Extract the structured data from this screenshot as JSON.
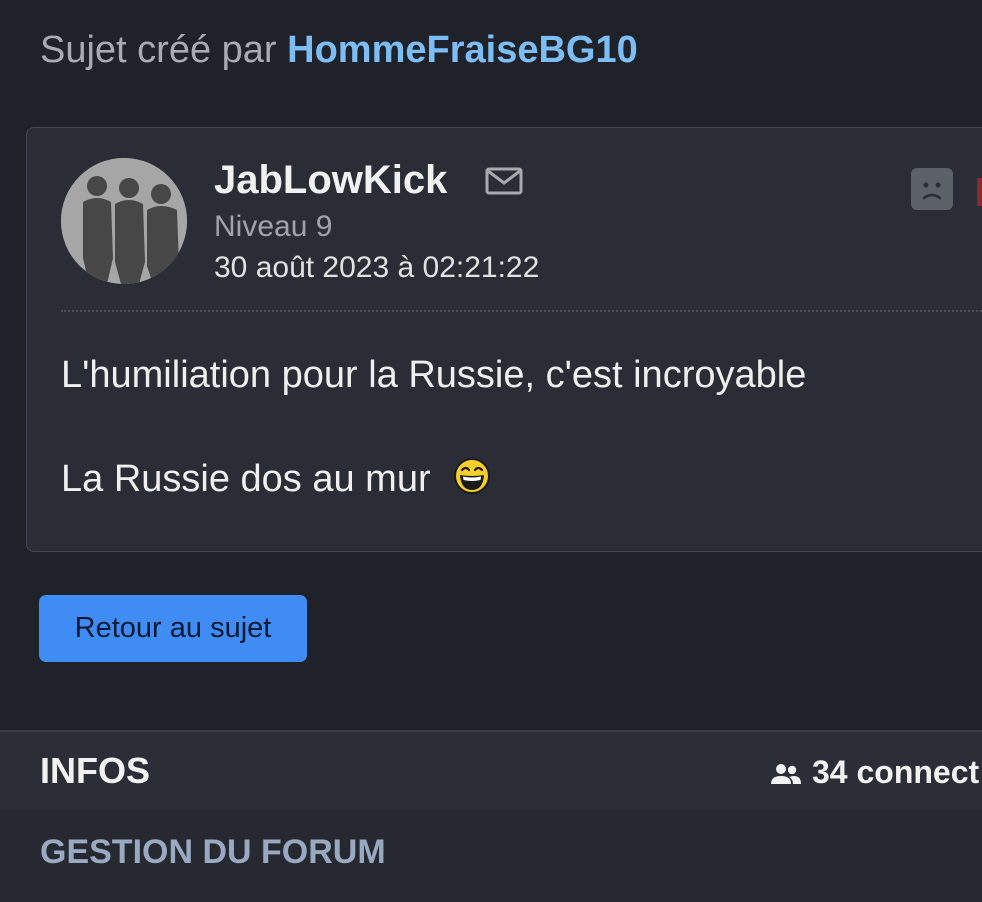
{
  "topic_header": {
    "prefix": "Sujet créé par",
    "author": "HommeFraiseBG10"
  },
  "post": {
    "username": "JabLowKick",
    "level": "Niveau 9",
    "date": "30 août 2023 à 02:21:22",
    "message_lines": [
      "L'humiliation pour la Russie, c'est incroyable",
      "La Russie dos au mur"
    ],
    "icons": {
      "mail": "mail-icon",
      "smiley": "sad-smiley-icon",
      "emoji": "laughing-smiley-emoji"
    }
  },
  "back_button": {
    "label": "Retour au sujet"
  },
  "infos": {
    "title": "INFOS",
    "connected": "34 connect"
  },
  "gestion": {
    "title": "GESTION DU FORUM"
  },
  "colors": {
    "background": "#1f2228",
    "card": "#2a2d35",
    "link": "#7cbdf5",
    "button": "#3f8cf4",
    "gestion_title": "#9aa9c2"
  }
}
